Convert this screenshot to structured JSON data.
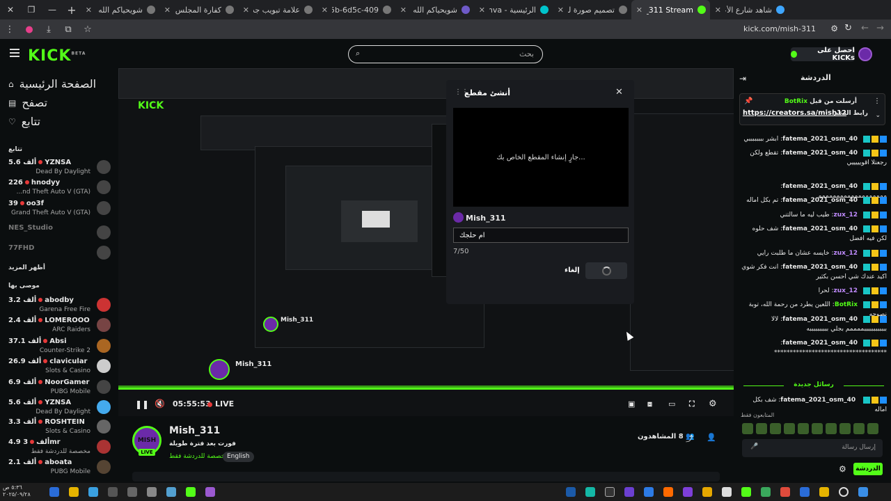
{
  "browser": {
    "tabs": [
      {
        "label": "شاهد شارع الأعشى - الـ",
        "color": "#3ea6ff"
      },
      {
        "label": "Mish_311 Stream",
        "color": "#53fc18",
        "active": true
      },
      {
        "label": "تصميم صورة لبث",
        "color": "#777"
      },
      {
        "label": "الرئيسية - Canva",
        "color": "#00c4cc"
      },
      {
        "label": "شويحياكم الله شوي و",
        "color": "#6e5ac8"
      },
      {
        "label": "0683875b-6d5c-409",
        "color": "#777"
      },
      {
        "label": "علامة تبويب جديدة",
        "color": "#777"
      },
      {
        "label": "كفارة المجلس - بحث",
        "color": "#777"
      },
      {
        "label": "شويحياكم الله شوي و",
        "color": "#777"
      }
    ],
    "url": "kick.com/mish-311"
  },
  "header": {
    "search_placeholder": "بحث",
    "kicks_button": "احصل على KICKs",
    "logo": "KICK",
    "logo_sup": "BETA"
  },
  "sidebar": {
    "nav": [
      {
        "label": "الصفحة الرئيسية",
        "icon": "home-icon"
      },
      {
        "label": "تصفح",
        "icon": "browse-icon"
      },
      {
        "label": "تتابع",
        "icon": "heart-icon"
      }
    ],
    "following_title": "تتابع",
    "following": [
      {
        "name": "YZNSA",
        "viewers": "5.6 ألف",
        "game": "Dead By Daylight"
      },
      {
        "name": "hnodyy",
        "viewers": "226",
        "game": "...nd Theft Auto V (GTA)"
      },
      {
        "name": "oo3f",
        "viewers": "39",
        "game": "Grand Theft Auto V (GTA)"
      },
      {
        "name": "NES_Studio",
        "viewers": "",
        "game": ""
      },
      {
        "name": "77FHD",
        "viewers": "",
        "game": ""
      }
    ],
    "show_more": "أظهر المزيد",
    "recommended_title": "موصى بها",
    "recommended": [
      {
        "name": "abodby",
        "viewers": "3.2 ألف",
        "game": "Garena Free Fire"
      },
      {
        "name": "LOMEROOO",
        "viewers": "2.4 ألف",
        "game": "ARC Raiders"
      },
      {
        "name": "Absi",
        "viewers": "37.1 ألف",
        "game": "Counter-Strike 2"
      },
      {
        "name": "clavicular",
        "viewers": "26.9 ألف",
        "game": "Slots & Casino"
      },
      {
        "name": "NoorGamer",
        "viewers": "6.9 ألف",
        "game": "PUBG Mobile"
      },
      {
        "name": "YZNSA",
        "viewers": "5.6 ألف",
        "game": "Dead By Daylight"
      },
      {
        "name": "ROSHTEIN",
        "viewers": "3.3 ألف",
        "game": "Slots & Casino"
      },
      {
        "name": "3mr",
        "viewers": "4.9 ألف",
        "game": "مخصصة للدردشة فقط"
      },
      {
        "name": "aboata",
        "viewers": "2.1 ألف",
        "game": "PUBG Mobile"
      }
    ]
  },
  "video": {
    "time": "05:55:53",
    "live": "LIVE"
  },
  "clip_modal": {
    "title": "أنشئ مقطع",
    "creating": "...جارٍ إنشاء المقطع الخاص بك",
    "channel": "Mish_311",
    "title_value": "ام حلجك",
    "counter": "7/50",
    "cancel": "إلغاء"
  },
  "stream_info": {
    "name": "Mish_311",
    "title": "فورت بعد فترة طويلة",
    "category": "مخصصة للدردشة فقط",
    "language": "English",
    "viewers": "8 المشاهدون",
    "avatar_text": "MISH",
    "live_badge": "LIVE"
  },
  "chat": {
    "title": "الدردشة",
    "pinned_by": "أرسلت من قبل",
    "pinned_user": "BotRix",
    "pinned_link": "https://creators.sa/mish12",
    "pinned_prefix": "رابط الدعم",
    "messages": [
      {
        "user": "fatema_2021_osm_40",
        "text": "ابشر ببببببببي",
        "color": "#e8e8e8"
      },
      {
        "user": "fatema_2021_osm_40",
        "text": "تقطع ولكن رجعتلا اقويييييي",
        "color": "#e8e8e8"
      },
      {
        "user": "fatema_2021_osm_40",
        "text": "ممممممممممممممممممم",
        "color": "#e8e8e8"
      },
      {
        "user": "fatema_2021_osm_40",
        "text": "تم بكل اماله",
        "color": "#e8e8e8"
      },
      {
        "user": "zux_12",
        "text": "طيب ليه ما سالتني",
        "color": "#c18cff"
      },
      {
        "user": "fatema_2021_osm_40",
        "text": "شف حلوه لكن فيه افضل",
        "color": "#e8e8e8"
      },
      {
        "user": "zux_12",
        "text": "خايسه عشان ما طلبت رايي",
        "color": "#c18cff"
      },
      {
        "user": "fatema_2021_osm_40",
        "text": "انت فكر شوي اكيد عندك شي احسن بكثير",
        "color": "#e8e8e8"
      },
      {
        "user": "zux_12",
        "text": "لحرا",
        "color": "#c18cff"
      },
      {
        "user": "BotRix",
        "text": "اللعين يطرد من رحمة الله، توبة نصوحه",
        "color": "#53fc18"
      },
      {
        "user": "fatema_2021_osm_40",
        "text": "لالا ببببببببببببممممم بجلي ببببببببببه",
        "color": "#e8e8e8"
      },
      {
        "user": "fatema_2021_osm_40",
        "text": "************************************",
        "color": "#e8e8e8"
      }
    ],
    "new_messages": "رسائل جديدة",
    "last_message": {
      "user": "fatema_2021_osm_40",
      "text": "شف بكل اماله"
    },
    "subs_only": "المتابعون فقط",
    "input_placeholder": "إرسال رسالة",
    "send": "الدردشة"
  },
  "taskbar": {
    "time": "٥:٣٦ ص",
    "date": "٢٠٢٥/٠٩/٢٨"
  },
  "colors": {
    "kick_green": "#53fc18",
    "bg": "#0b0e0f"
  }
}
